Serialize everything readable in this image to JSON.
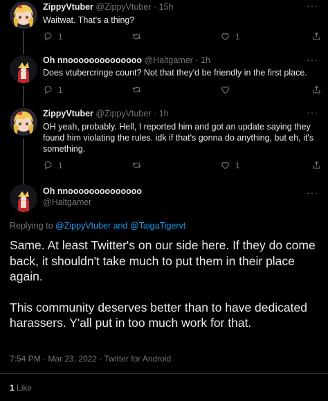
{
  "tweets": [
    {
      "name": "ZippyVtuber",
      "handle": "@ZippyVtuber",
      "sep": "·",
      "time": "15h",
      "text": "Waitwat. That's a thing?",
      "reply_count": "1",
      "retweet_count": "",
      "like_count": "1"
    },
    {
      "name": "Oh nnoooooooooooooo",
      "handle": "@Haltgamer",
      "sep": "·",
      "time": "1h",
      "text": "Does vtubercringe count? Not that they'd be friendly in the first place.",
      "reply_count": "1",
      "retweet_count": "",
      "like_count": ""
    },
    {
      "name": "ZippyVtuber",
      "handle": "@ZippyVtuber",
      "sep": "·",
      "time": "1h",
      "text": "OH yeah, probably. Hell, I reported him and got an update saying they found him violating the rules. idk if that's gonna do anything, but eh, it's something.",
      "reply_count": "1",
      "retweet_count": "",
      "like_count": "1"
    }
  ],
  "main_tweet": {
    "name": "Oh nnoooooooooooooo",
    "handle": "@Haltgamer",
    "replying_prefix": "Replying to",
    "mention_1": "@ZippyVtuber",
    "and": "and",
    "mention_2": "@TaigaTigervt",
    "paragraph_1": "Same. At least Twitter's on our side here. If they do come back, it shouldn't take much to put them in their place again.",
    "paragraph_2": "This community deserves better than to have dedicated harassers. Y'all put in too much work for that.",
    "meta": "7:54 PM · Mar 23, 2022 · Twitter for Android",
    "like_count": "1",
    "like_label": "Like"
  },
  "colors": {
    "background": "#000000",
    "text": "#e7e9ea",
    "secondary": "#71767b",
    "accent": "#1d9bf0",
    "divider": "#2f3336"
  },
  "icons": [
    "reply-icon",
    "retweet-icon",
    "like-icon",
    "share-icon",
    "more-icon"
  ]
}
